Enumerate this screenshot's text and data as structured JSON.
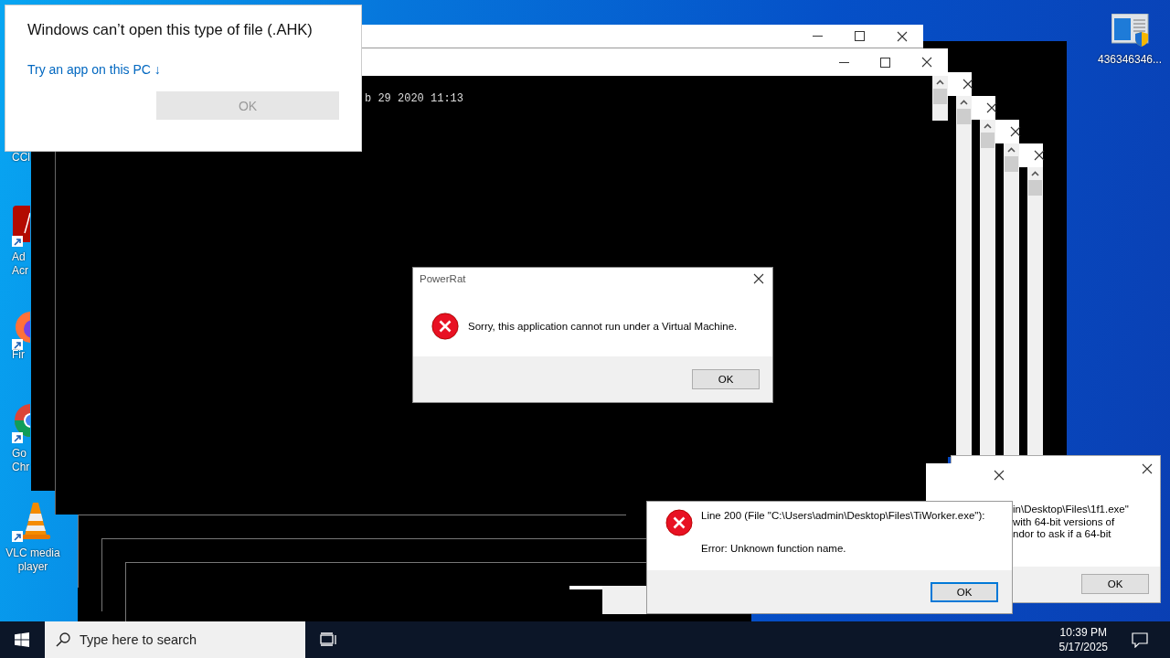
{
  "desktop_icons": [
    {
      "kind": "blank",
      "lines": [
        "CCl"
      ]
    },
    {
      "kind": "pdf",
      "lines": [
        "Ad",
        "Acr"
      ]
    },
    {
      "kind": "firefox",
      "lines": [
        "Fir"
      ]
    },
    {
      "kind": "chrome",
      "lines": [
        "Go",
        "Chr"
      ]
    },
    {
      "kind": "vlc",
      "lines": [
        "VLC media",
        "player"
      ]
    }
  ],
  "desktop_shortcut": {
    "label": "436346346..."
  },
  "console": {
    "output_line": "b 29 2020 11:13"
  },
  "open_with_dialog": {
    "title": "Windows can’t open this type of file (.AHK)",
    "link": "Try an app on this PC ↓",
    "button": {
      "label": "OK",
      "disabled": true
    }
  },
  "message_box": {
    "title": "PowerRat",
    "message": "Sorry, this application cannot run under a Virtual Machine.",
    "button": {
      "label": "OK",
      "focused": false
    }
  },
  "error_box": {
    "lines": [
      "Line 200  (File \"C:\\Users\\admin\\Desktop\\Files\\TiWorker.exe\"):",
      "Error: Unknown function name."
    ],
    "button": {
      "label": "OK",
      "focused": true
    }
  },
  "partial_dialog": {
    "lines": [
      "in\\Desktop\\Files\\1f1.exe\"",
      "with 64-bit versions of",
      "ndor to ask if a 64-bit"
    ],
    "button": {
      "label": "OK",
      "focused": false
    }
  },
  "taskbar": {
    "search": {
      "placeholder": "Type here to search"
    },
    "time": "10:39 PM",
    "date": "5/17/2025"
  }
}
